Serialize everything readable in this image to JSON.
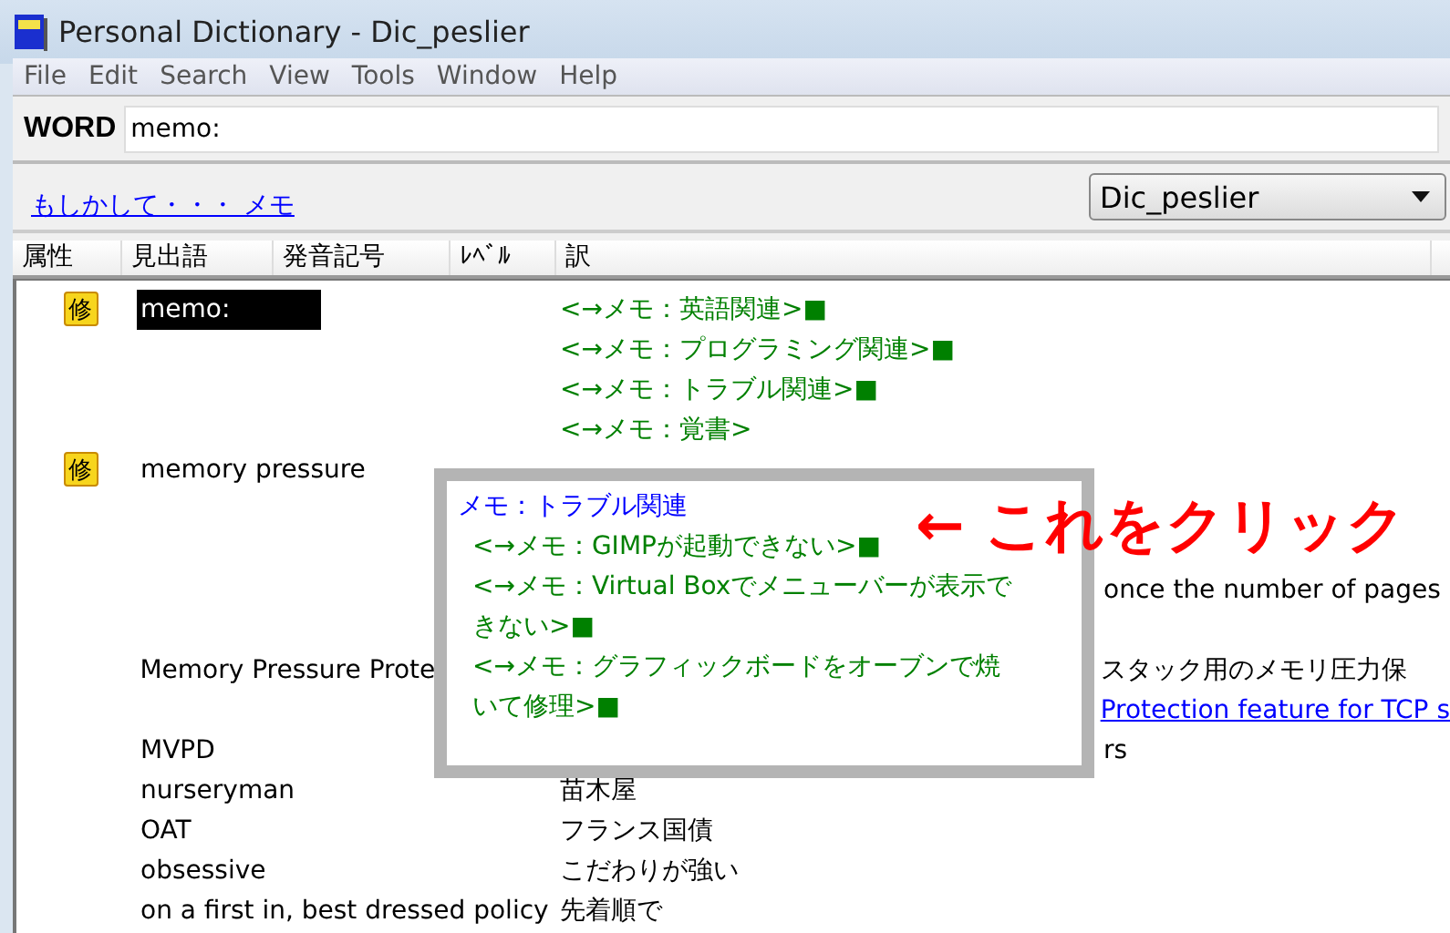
{
  "window": {
    "title": "Personal Dictionary - Dic_peslier"
  },
  "menu": [
    "File",
    "Edit",
    "Search",
    "View",
    "Tools",
    "Window",
    "Help"
  ],
  "search": {
    "label": "WORD",
    "value": "memo:"
  },
  "suggestion": "もしかして・・・ メモ",
  "dictionary_select": {
    "value": "Dic_peslier"
  },
  "columns": [
    "属性",
    "見出語",
    "発音記号",
    "ﾚﾍﾞﾙ",
    "訳"
  ],
  "rows": [
    {
      "badge": "修",
      "headword": "memo:",
      "selected": true,
      "translations": [
        {
          "kind": "memo",
          "text": "<→メモ：英語関連>■"
        },
        {
          "kind": "memo",
          "text": "<→メモ：プログラミング関連>■"
        },
        {
          "kind": "memo",
          "text": "<→メモ：トラブル関連>■"
        },
        {
          "kind": "memo",
          "text": "<→メモ：覚書>"
        }
      ]
    },
    {
      "badge": "修",
      "headword": "memory pressure",
      "selected": false,
      "translations": [
        {
          "kind": "partial-low",
          "text": "once the number of pages"
        }
      ]
    },
    {
      "headword": "Memory Pressure Prote",
      "selected": false,
      "translations": [
        {
          "kind": "partial",
          "text": "スタック用のメモリ圧力保"
        },
        {
          "kind": "partial-link",
          "text": "Protection feature for TCP s"
        }
      ]
    },
    {
      "headword": "MVPD",
      "selected": false,
      "translations": [
        {
          "kind": "partial",
          "text": "rs"
        }
      ]
    },
    {
      "headword": "nurseryman",
      "selected": false,
      "translations": [
        {
          "kind": "plain",
          "text": "苗木屋"
        }
      ]
    },
    {
      "headword": "OAT",
      "selected": false,
      "translations": [
        {
          "kind": "plain",
          "text": "フランス国債"
        }
      ]
    },
    {
      "headword": "obsessive",
      "selected": false,
      "translations": [
        {
          "kind": "plain",
          "text": "こだわりが強い"
        }
      ]
    },
    {
      "headword": "on a first in, best dressed policy",
      "selected": false,
      "translations": [
        {
          "kind": "plain",
          "text": "先着順で"
        }
      ]
    }
  ],
  "popup": {
    "title": "メモ：トラブル関連",
    "items": [
      "<→メモ：GIMPが起動できない>■",
      "<→メモ：Virtual Boxでメニューバーが表示できない>■",
      "<→メモ：グラフィックボードをオーブンで焼いて修理>■"
    ]
  },
  "annotation": "← これをクリック"
}
